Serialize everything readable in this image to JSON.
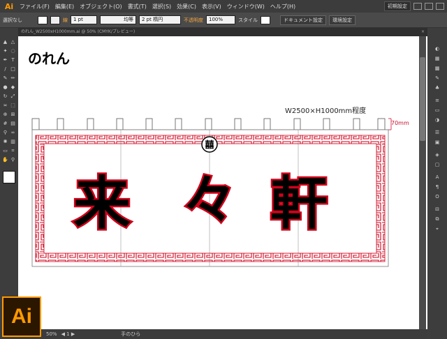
{
  "app": {
    "logo": "Ai",
    "name": "Adobe Illustrator"
  },
  "menu": {
    "items": [
      "ファイル(F)",
      "編集(E)",
      "オブジェクト(O)",
      "書式(T)",
      "選択(S)",
      "効果(C)",
      "表示(V)",
      "ウィンドウ(W)",
      "ヘルプ(H)"
    ],
    "workspace_label": "初期設定"
  },
  "control": {
    "selection_label": "選択なし",
    "stroke_label": "線",
    "stroke_value": "1 pt",
    "profile_label": "均等",
    "brush_label": "2 pt 楕円",
    "opacity_label": "不透明度",
    "opacity_value": "100%",
    "style_label": "スタイル",
    "doc_settings_label": "ドキュメント設定",
    "prefs_label": "環境設定"
  },
  "document_tab": {
    "title": "のれん_W2500xH1000mm.ai @ 50% (CMYK/プレビュー)",
    "close": "×"
  },
  "artwork": {
    "title": "のれん",
    "dimension_text": "W2500×H1000mm程度",
    "loop_height_text": "70mm",
    "shop_name": [
      "来",
      "々",
      "軒"
    ],
    "emblem_char": "囍",
    "border_color": "#d0021b",
    "text_color": "#000000",
    "outline_color": "#d0021b"
  },
  "status": {
    "zoom": "50%",
    "tool_name": "手のひら"
  },
  "icons": {
    "toolbar": [
      "selection-arrow-icon",
      "direct-selection-icon",
      "magic-wand-icon",
      "lasso-icon",
      "pen-icon",
      "type-icon",
      "line-icon",
      "rectangle-icon",
      "paintbrush-icon",
      "pencil-icon",
      "blob-brush-icon",
      "eraser-icon",
      "rotate-icon",
      "scale-icon",
      "width-icon",
      "free-transform-icon",
      "shape-builder-icon",
      "perspective-grid-icon",
      "mesh-icon",
      "gradient-icon",
      "eyedropper-icon",
      "blend-icon",
      "symbol-sprayer-icon",
      "graph-icon",
      "artboard-icon",
      "slice-icon",
      "hand-icon",
      "zoom-icon"
    ],
    "panels": [
      "color-panel-icon",
      "color-guide-icon",
      "swatches-icon",
      "brushes-icon",
      "symbols-icon",
      "stroke-icon",
      "gradient-panel-icon",
      "transparency-icon",
      "appearance-icon",
      "graphic-styles-icon",
      "layers-icon",
      "artboards-panel-icon",
      "character-icon",
      "paragraph-icon",
      "opentype-icon",
      "align-icon",
      "pathfinder-icon",
      "transform-icon"
    ]
  }
}
